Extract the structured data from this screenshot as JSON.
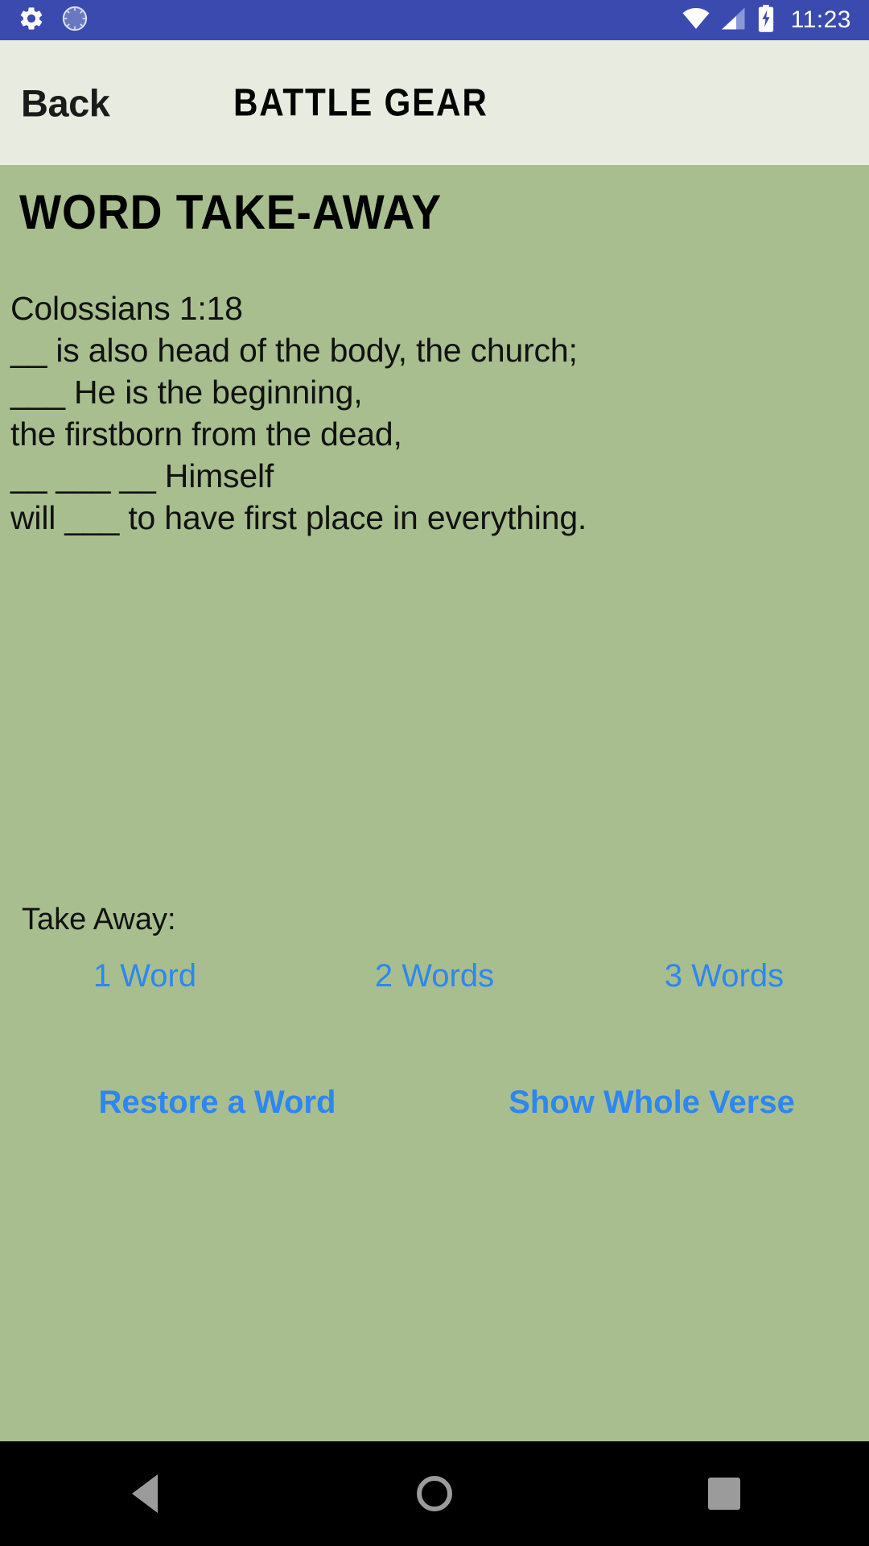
{
  "status_bar": {
    "icons_left": [
      "gear-icon",
      "clock-dial-icon"
    ],
    "icons_right": [
      "wifi-icon",
      "cell-signal-icon",
      "battery-charging-icon"
    ],
    "time": "11:23",
    "background_color": "#3A4AAE",
    "foreground_color": "#FFFFFF"
  },
  "app_bar": {
    "back_label": "Back",
    "title": "BATTLE GEAR",
    "background_color": "#E8ECE0"
  },
  "main": {
    "background_color": "#A8BE8E",
    "heading": "WORD TAKE-AWAY",
    "verse": {
      "reference": "Colossians 1:18",
      "lines": [
        "Colossians 1:18",
        "__ is also head of the body, the church;",
        "___ He is the beginning,",
        "the firstborn from the dead,",
        "__ ___ __ Himself",
        "will ___ to have first place in everything."
      ]
    },
    "takeaway": {
      "label": "Take Away:",
      "options": [
        "1 Word",
        "2 Words",
        "3 Words"
      ],
      "link_color": "#2E86F0"
    },
    "actions": [
      "Restore a Word",
      "Show Whole Verse"
    ]
  },
  "nav_bar": {
    "background_color": "#000000",
    "buttons": [
      "back-triangle-icon",
      "home-circle-icon",
      "recents-square-icon"
    ]
  }
}
